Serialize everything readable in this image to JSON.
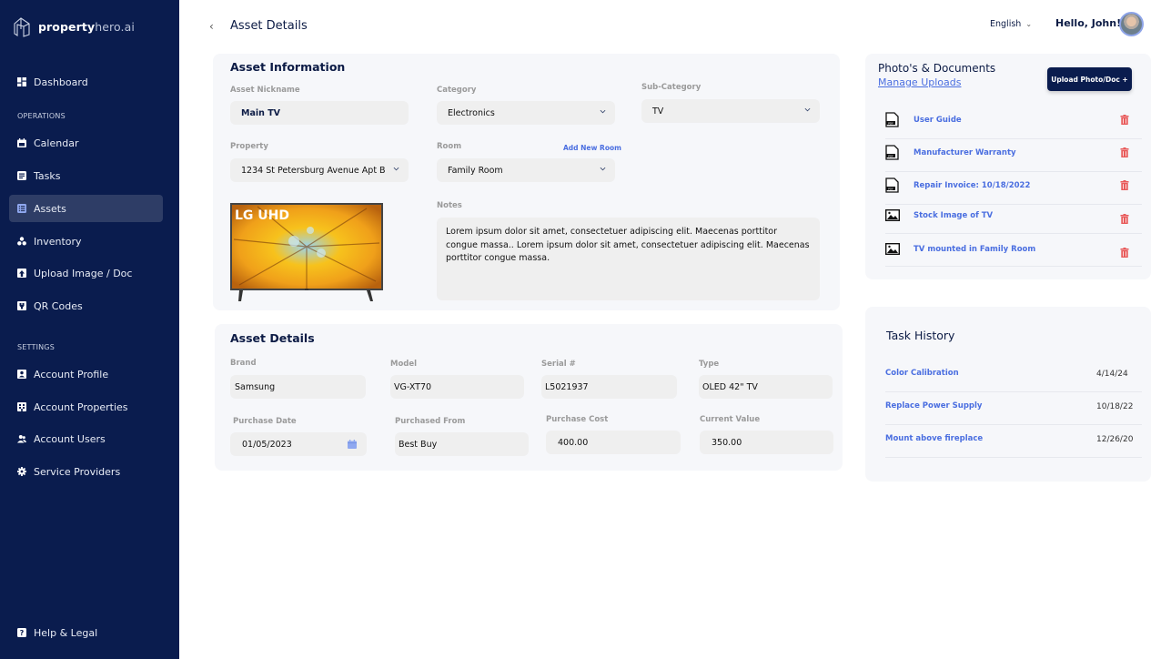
{
  "brand": {
    "name_bold": "property",
    "name_light": "hero.ai"
  },
  "sidebar": {
    "items_top": [
      {
        "label": "Dashboard",
        "icon": "dashboard-icon"
      }
    ],
    "section_operations": "OPERATIONS",
    "operations": [
      {
        "label": "Calendar",
        "icon": "calendar-icon"
      },
      {
        "label": "Tasks",
        "icon": "tasks-icon"
      },
      {
        "label": "Assets",
        "icon": "assets-icon",
        "active": true
      },
      {
        "label": "Inventory",
        "icon": "inventory-icon"
      },
      {
        "label": "Upload Image / Doc",
        "icon": "upload-icon"
      },
      {
        "label": "QR Codes",
        "icon": "qr-code-icon"
      }
    ],
    "section_settings": "SETTINGS",
    "settings": [
      {
        "label": "Account Profile",
        "icon": "profile-icon"
      },
      {
        "label": "Account Properties",
        "icon": "properties-icon"
      },
      {
        "label": "Account Users",
        "icon": "users-icon"
      },
      {
        "label": "Service Providers",
        "icon": "gear-icon"
      }
    ],
    "help": {
      "label": "Help & Legal",
      "icon": "help-icon"
    }
  },
  "header": {
    "back": "‹",
    "title": "Asset Details",
    "language": "English",
    "greeting": "Hello, John!"
  },
  "asset_info": {
    "title": "Asset Information",
    "nickname_label": "Asset Nickname",
    "nickname": "Main TV",
    "category_label": "Category",
    "category": "Electronics",
    "subcategory_label": "Sub-Category",
    "subcategory": "TV",
    "property_label": "Property",
    "property": "1234 St Petersburg Avenue Apt B",
    "room_label": "Room",
    "add_room": "Add New Room",
    "room": "Family Room",
    "image_caption": "LG UHD",
    "notes_label": "Notes",
    "notes": "Lorem ipsum dolor sit amet, consectetuer adipiscing elit. Maecenas porttitor congue massa..  Lorem ipsum dolor sit amet, consectetuer adipiscing elit. Maecenas porttitor congue massa."
  },
  "asset_details": {
    "title": "Asset Details",
    "brand_label": "Brand",
    "brand": "Samsung",
    "model_label": "Model",
    "model": "VG-XT70",
    "serial_label": "Serial #",
    "serial": "L5021937",
    "type_label": "Type",
    "type": "OLED 42\" TV",
    "purchase_date_label": "Purchase Date",
    "purchase_date": "01/05/2023",
    "purchased_from_label": "Purchased From",
    "purchased_from": "Best Buy",
    "purchase_cost_label": "Purchase Cost",
    "purchase_cost": "400.00",
    "current_value_label": "Current Value",
    "current_value": "350.00"
  },
  "documents": {
    "title": "Photo's & Documents",
    "manage": "Manage Uploads",
    "upload_button": "Upload Photo/Doc +",
    "items": [
      {
        "name": "User Guide",
        "type": "pdf"
      },
      {
        "name": "Manufacturer Warranty",
        "type": "pdf"
      },
      {
        "name": "Repair Invoice: 10/18/2022",
        "type": "pdf"
      },
      {
        "name": "Stock Image of TV",
        "type": "image"
      },
      {
        "name": "TV mounted in Family Room",
        "type": "image"
      }
    ]
  },
  "task_history": {
    "title": "Task History",
    "items": [
      {
        "name": "Color Calibration",
        "date": "4/14/24"
      },
      {
        "name": "Replace Power Supply",
        "date": "10/18/22"
      },
      {
        "name": "Mount above fireplace",
        "date": "12/26/20"
      }
    ]
  },
  "colors": {
    "sidebar": "#0a1c4e",
    "accent": "#4a6ee0",
    "danger": "#e85a5a",
    "card": "#f6f7fa"
  }
}
